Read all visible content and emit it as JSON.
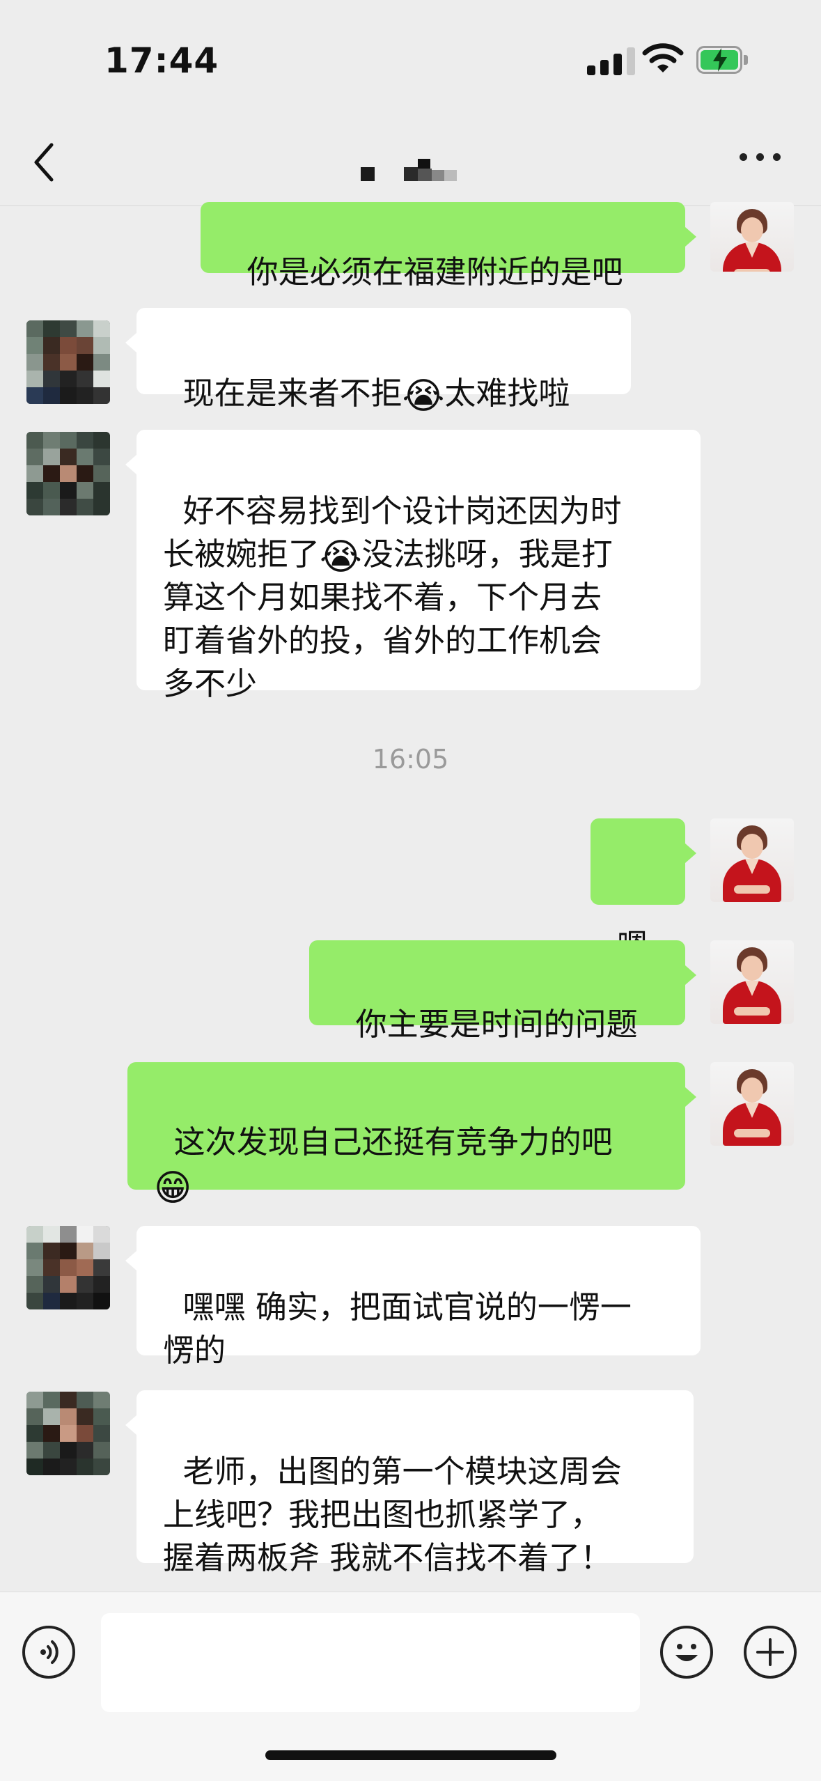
{
  "status_bar": {
    "time": "17:44",
    "battery_charging": true
  },
  "header": {
    "contact_name_obscured": true
  },
  "timestamp": "16:05",
  "messages": [
    {
      "side": "out",
      "text": "你是必须在福建附近的是吧"
    },
    {
      "side": "in",
      "text": "现在是来者不拒",
      "emoji": "😭",
      "text_after": "太难找啦"
    },
    {
      "side": "in",
      "line1": "好不容易找到个设计岗还因为时",
      "line2_before": "长被婉拒了",
      "emoji": "😭",
      "line2_after": "没法挑呀，我是打",
      "rest": "算这个月如果找不着，下个月去\n盯着省外的投，省外的工作机会\n多不少"
    },
    {
      "side": "out",
      "text": "嗯"
    },
    {
      "side": "out",
      "text": "你主要是时间的问题"
    },
    {
      "side": "out",
      "text": "这次发现自己还挺有竞争力的吧",
      "emoji": "😁"
    },
    {
      "side": "in",
      "text": "嘿嘿 确实，把面试官说的一愣一\n愣的"
    },
    {
      "side": "in",
      "text": "老师，出图的第一个模块这周会\n上线吧？我把出图也抓紧学了，\n握着两板斧 我就不信找不着了！"
    }
  ],
  "input_bar": {
    "voice_icon": "voice-icon",
    "emoji_icon": "emoji-icon",
    "plus_icon": "plus-icon"
  },
  "colors": {
    "background": "#ededed",
    "outgoing_bubble": "#95ec69",
    "incoming_bubble": "#ffffff",
    "timestamp": "#9a9a9a"
  }
}
